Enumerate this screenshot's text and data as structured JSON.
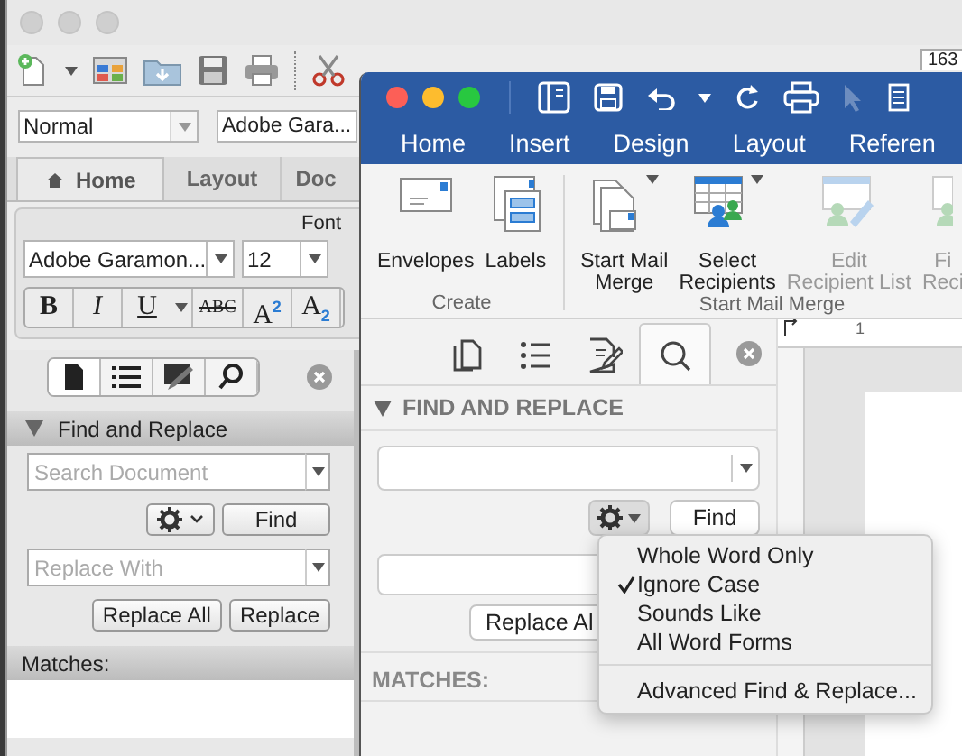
{
  "back_window": {
    "toolbar": {
      "zoom": "163"
    },
    "style_row": {
      "style": "Normal",
      "font_preview": "Adobe Gara..."
    },
    "tabs": [
      {
        "label": "Home",
        "selected": true
      },
      {
        "label": "Layout",
        "selected": false
      },
      {
        "label": "Doc",
        "selected": false
      }
    ],
    "font_group": {
      "title": "Font",
      "font": "Adobe Garamon...",
      "size": "12",
      "buttons": [
        {
          "kind": "bold",
          "label": "B"
        },
        {
          "kind": "italic",
          "label": "I"
        },
        {
          "kind": "underline",
          "label": "U"
        },
        {
          "kind": "strike",
          "label": "ABC"
        },
        {
          "kind": "script",
          "label": "A$^{2}$"
        },
        {
          "kind": "script",
          "label": "A$_{2}$"
        }
      ]
    },
    "sidebar": {
      "tabs": [
        {
          "kind": "page",
          "selected": true
        },
        {
          "kind": "outline",
          "selected": false
        },
        {
          "kind": "edit",
          "selected": false
        },
        {
          "kind": "search",
          "selected": false
        }
      ],
      "title": "Find and Replace",
      "search_placeholder": "Search Document",
      "find": "Find",
      "replace_placeholder": "Replace With",
      "replace_all": "Replace All",
      "replace": "Replace",
      "matches": "Matches:"
    }
  },
  "front_window": {
    "tabs": [
      "Home",
      "Insert",
      "Design",
      "Layout",
      "Referen"
    ],
    "ribbon": [
      {
        "label": "Create",
        "buttons": [
          {
            "lines": [
              "Envelopes"
            ],
            "dropdown": false,
            "disabled": false
          },
          {
            "lines": [
              "Labels"
            ],
            "dropdown": false,
            "disabled": false
          }
        ]
      },
      {
        "label": "Start Mail Merge",
        "buttons": [
          {
            "lines": [
              "Start Mail",
              "Merge"
            ],
            "dropdown": true,
            "disabled": false
          },
          {
            "lines": [
              "Select",
              "Recipients"
            ],
            "dropdown": true,
            "disabled": false
          },
          {
            "lines": [
              "Edit",
              "Recipient List"
            ],
            "dropdown": false,
            "disabled": true
          },
          {
            "lines": [
              "Fi",
              "Reci"
            ],
            "dropdown": false,
            "disabled": true
          }
        ]
      }
    ],
    "pane": {
      "tabs": [
        {
          "kind": "page",
          "selected": false
        },
        {
          "kind": "outline",
          "selected": false
        },
        {
          "kind": "edit",
          "selected": false
        },
        {
          "kind": "search",
          "selected": true
        }
      ],
      "title": "FIND AND REPLACE",
      "find": "Find",
      "replace_all": "Replace Al",
      "matches": "MATCHES:"
    },
    "ruler_mark": "1"
  },
  "options_menu": {
    "items": [
      {
        "label": "Whole Word Only",
        "checked": false
      },
      {
        "label": "Ignore Case",
        "checked": true
      },
      {
        "label": "Sounds Like",
        "checked": false
      },
      {
        "label": "All Word Forms",
        "checked": false
      }
    ],
    "footer": "Advanced Find & Replace..."
  }
}
